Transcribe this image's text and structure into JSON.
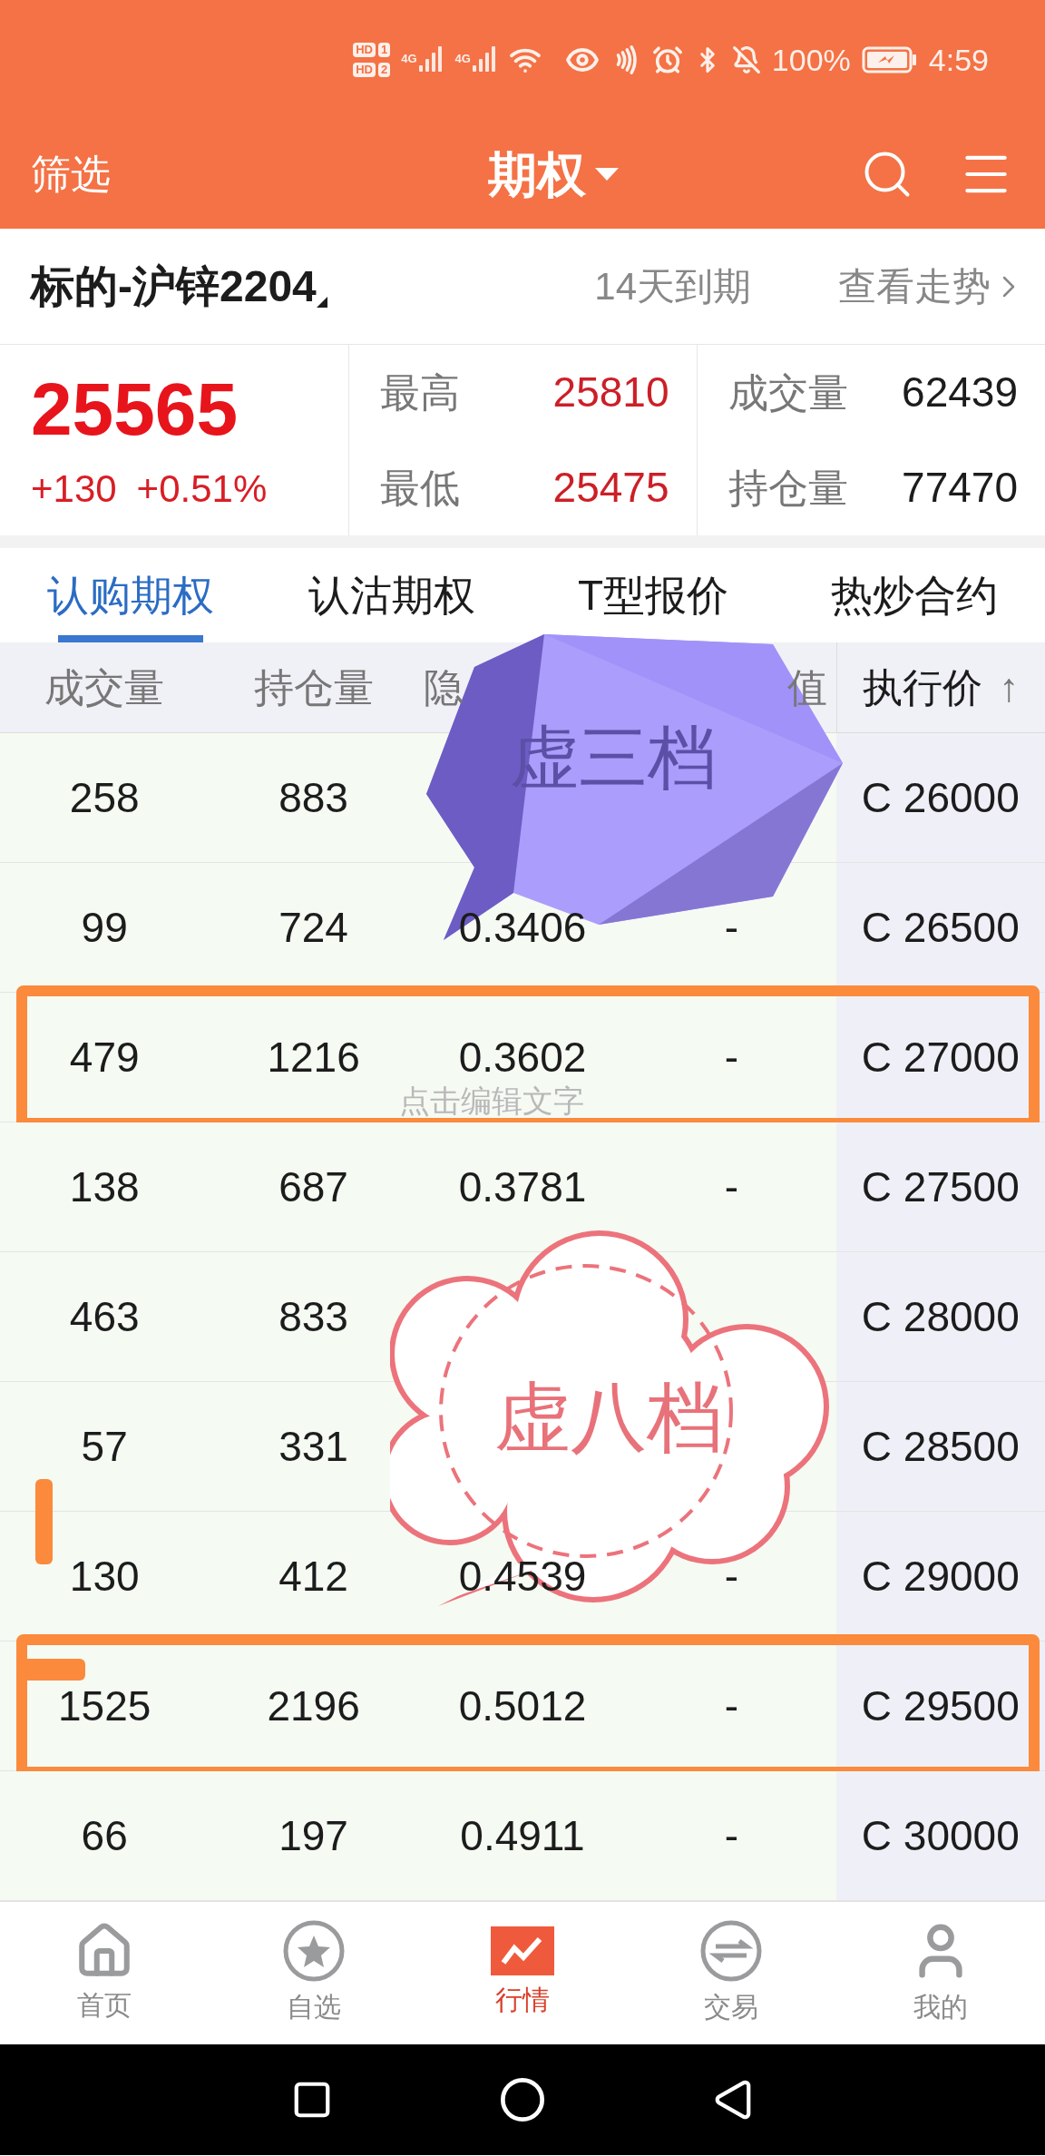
{
  "status_bar": {
    "sims": [
      {
        "hd": "HD",
        "slot": "1"
      },
      {
        "hd": "HD",
        "slot": "2"
      }
    ],
    "networks": [
      "4G",
      "4G"
    ],
    "battery": "100%",
    "time": "4:59"
  },
  "header": {
    "filter": "筛选",
    "title": "期权"
  },
  "underlying": {
    "name": "标的-沪锌2204",
    "expiry": "14天到期",
    "trend_link": "查看走势"
  },
  "quote": {
    "price": "25565",
    "change": "+130",
    "change_pct": "+0.51%",
    "stats": [
      {
        "label": "最高",
        "value": "25810",
        "kind": "price"
      },
      {
        "label": "成交量",
        "value": "62439",
        "kind": "plain"
      },
      {
        "label": "最低",
        "value": "25475",
        "kind": "price"
      },
      {
        "label": "持仓量",
        "value": "77470",
        "kind": "plain"
      }
    ]
  },
  "tabs": [
    {
      "label": "认购期权",
      "selected": true
    },
    {
      "label": "认沽期权",
      "selected": false
    },
    {
      "label": "T型报价",
      "selected": false
    },
    {
      "label": "热炒合约",
      "selected": false
    }
  ],
  "table": {
    "columns": [
      {
        "label": "成交量"
      },
      {
        "label": "持仓量"
      },
      {
        "label": "隐"
      },
      {
        "label": "值"
      },
      {
        "label": "执行价",
        "sort": "↑"
      }
    ],
    "rows": [
      {
        "volume": "258",
        "open_interest": "883",
        "strike": "C 26000",
        "framed": false
      },
      {
        "volume": "99",
        "open_interest": "724",
        "iv": "0.3406",
        "column_4": "-",
        "strike": "C 26500",
        "framed": false
      },
      {
        "volume": "479",
        "open_interest": "1216",
        "iv": "0.3602",
        "column_4": "-",
        "strike": "C 27000",
        "framed": true
      },
      {
        "volume": "138",
        "open_interest": "687",
        "iv": "0.3781",
        "column_4": "-",
        "strike": "C 27500",
        "framed": false
      },
      {
        "volume": "463",
        "open_interest": "833",
        "strike": "C 28000",
        "framed": false
      },
      {
        "volume": "57",
        "open_interest": "331",
        "strike": "C 28500",
        "framed": false
      },
      {
        "volume": "130",
        "open_interest": "412",
        "iv": "0.4539",
        "column_4": "-",
        "strike": "C 29000",
        "framed": false
      },
      {
        "volume": "1525",
        "open_interest": "2196",
        "iv": "0.5012",
        "column_4": "-",
        "strike": "C 29500",
        "framed": true
      },
      {
        "volume": "66",
        "open_interest": "197",
        "iv": "0.4911",
        "column_4": "-",
        "strike": "C 30000",
        "framed": false
      }
    ]
  },
  "annotations": [
    {
      "kind": "polygon_bubble",
      "text": "虚三档"
    },
    {
      "kind": "cloud_bubble",
      "text": "虚八档"
    },
    {
      "kind": "hint",
      "text": "点击编辑文字"
    },
    {
      "kind": "bar_mark"
    },
    {
      "kind": "dash_mark"
    }
  ],
  "nav": [
    {
      "label": "首页",
      "kind": "home",
      "selected": false
    },
    {
      "label": "自选",
      "kind": "star",
      "selected": false
    },
    {
      "label": "行情",
      "kind": "market",
      "selected": true
    },
    {
      "label": "交易",
      "kind": "trade",
      "selected": false
    },
    {
      "label": "我的",
      "kind": "user",
      "selected": false
    }
  ]
}
